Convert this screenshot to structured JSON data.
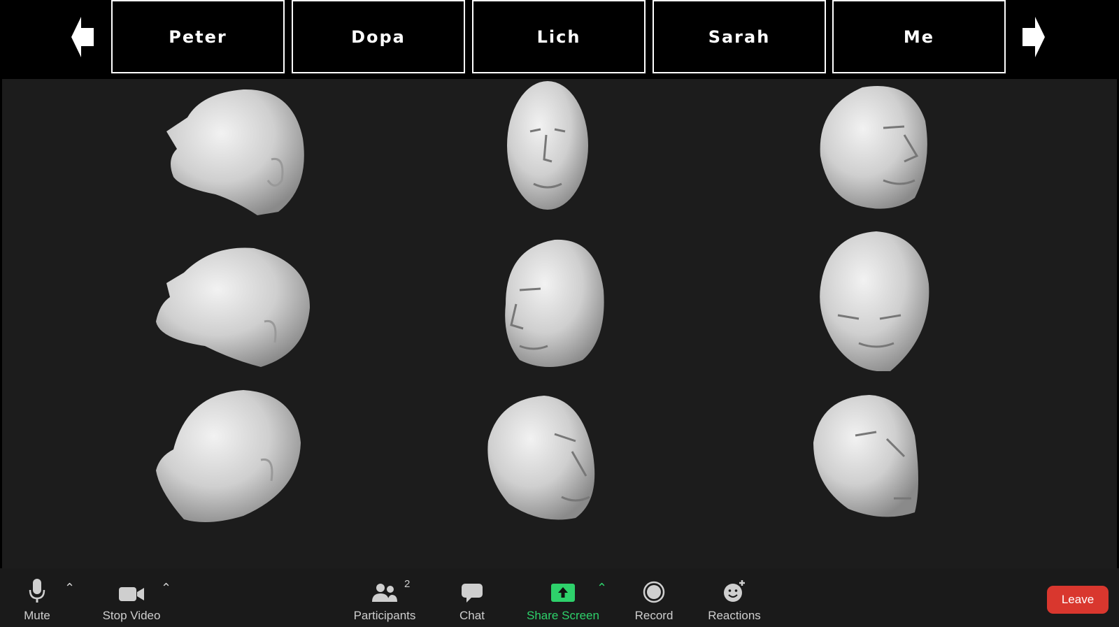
{
  "top_bar": {
    "prev_icon": "arrow-left-icon",
    "next_icon": "arrow-right-icon",
    "names": [
      "Peter",
      "Dopa",
      "Lich",
      "Sarah",
      "Me"
    ]
  },
  "stage": {
    "background": "#1c1c1c",
    "head_rows": 3,
    "head_columns": 3
  },
  "toolbar": {
    "mute_label": "Mute",
    "stop_video_label": "Stop Video",
    "participants_label": "Participants",
    "participants_count": "2",
    "chat_label": "Chat",
    "share_label": "Share Screen",
    "record_label": "Record",
    "reactions_label": "Reactions",
    "leave_label": "Leave",
    "share_color": "#2ed16b",
    "leave_color": "#d9372e"
  }
}
